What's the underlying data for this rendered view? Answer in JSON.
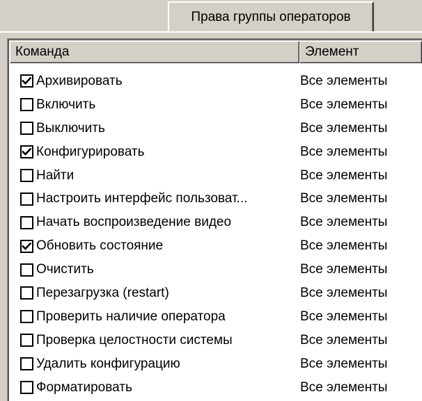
{
  "tab": {
    "label": "Права группы операторов"
  },
  "columns": {
    "command": "Команда",
    "element": "Элемент"
  },
  "rows": [
    {
      "command": "Архивировать",
      "element": "Все элементы",
      "checked": true
    },
    {
      "command": "Включить",
      "element": "Все элементы",
      "checked": false
    },
    {
      "command": "Выключить",
      "element": "Все элементы",
      "checked": false
    },
    {
      "command": "Конфигурировать",
      "element": "Все элементы",
      "checked": true
    },
    {
      "command": "Найти",
      "element": "Все элементы",
      "checked": false
    },
    {
      "command": "Настроить интерфейс пользоват...",
      "element": "Все элементы",
      "checked": false
    },
    {
      "command": "Начать воспроизведение видео",
      "element": "Все элементы",
      "checked": false
    },
    {
      "command": "Обновить состояние",
      "element": "Все элементы",
      "checked": true
    },
    {
      "command": "Очистить",
      "element": "Все элементы",
      "checked": false
    },
    {
      "command": "Перезагрузка (restart)",
      "element": "Все элементы",
      "checked": false
    },
    {
      "command": "Проверить наличие оператора",
      "element": "Все элементы",
      "checked": false
    },
    {
      "command": "Проверка целостности системы",
      "element": "Все элементы",
      "checked": false
    },
    {
      "command": "Удалить конфигурацию",
      "element": "Все элементы",
      "checked": false
    },
    {
      "command": "Форматировать",
      "element": "Все элементы",
      "checked": false
    }
  ],
  "icons": {
    "checkbox_mark": "checkmark-icon"
  },
  "colors": {
    "face": "#d4d0c8",
    "list_bg": "#ffffff",
    "text": "#000000"
  }
}
